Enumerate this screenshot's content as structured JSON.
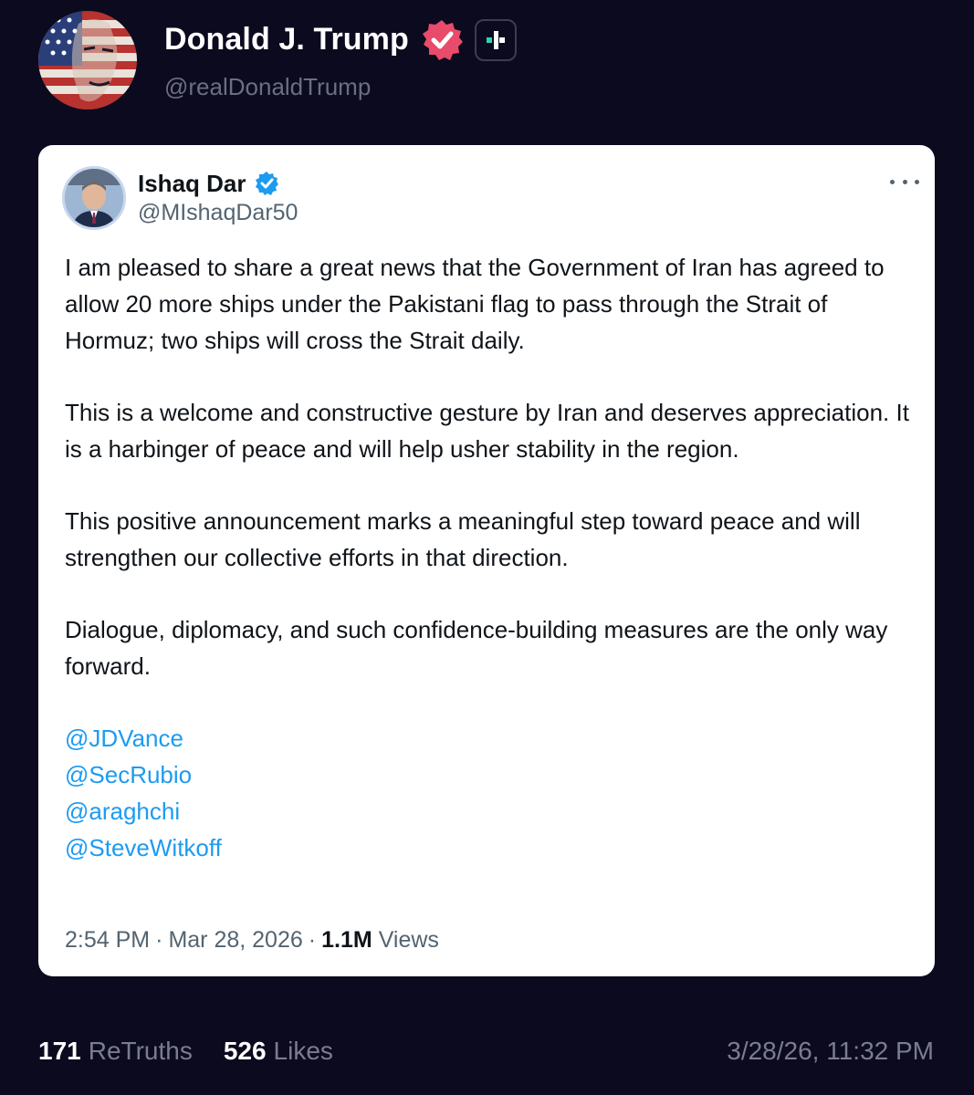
{
  "author": {
    "display_name": "Donald J. Trump",
    "handle": "@realDonaldTrump",
    "verified_badge_color": "#e94b6a"
  },
  "quoted_post": {
    "display_name": "Ishaq Dar",
    "handle": "@MIshaqDar50",
    "verified_badge_color": "#1d9bf0",
    "paragraphs": [
      "I am pleased to share a great news that the Government of Iran has agreed to allow 20 more ships under the Pakistani flag to pass through the Strait of Hormuz; two ships will cross the Strait daily.",
      "This is a welcome and constructive gesture by Iran and deserves appreciation. It is a harbinger of peace and will help usher stability in the region.",
      "This positive announcement marks a meaningful step toward peace and will strengthen our collective efforts in that direction.",
      "Dialogue, diplomacy, and such confidence-building measures are the only way forward."
    ],
    "mentions": [
      "@JDVance",
      "@SecRubio",
      "@araghchi",
      "@SteveWitkoff"
    ],
    "time": "2:54 PM",
    "date": "Mar 28, 2026",
    "views_count": "1.1M",
    "views_label": "Views",
    "separator": "·",
    "mention_color": "#1d9bf0"
  },
  "stats": {
    "retruths_count": "171",
    "retruths_label": "ReTruths",
    "likes_count": "526",
    "likes_label": "Likes",
    "timestamp": "3/28/26, 11:32 PM"
  },
  "colors": {
    "background": "#0c0a1e",
    "card_background": "#ffffff",
    "muted_text": "#7a7d91"
  }
}
